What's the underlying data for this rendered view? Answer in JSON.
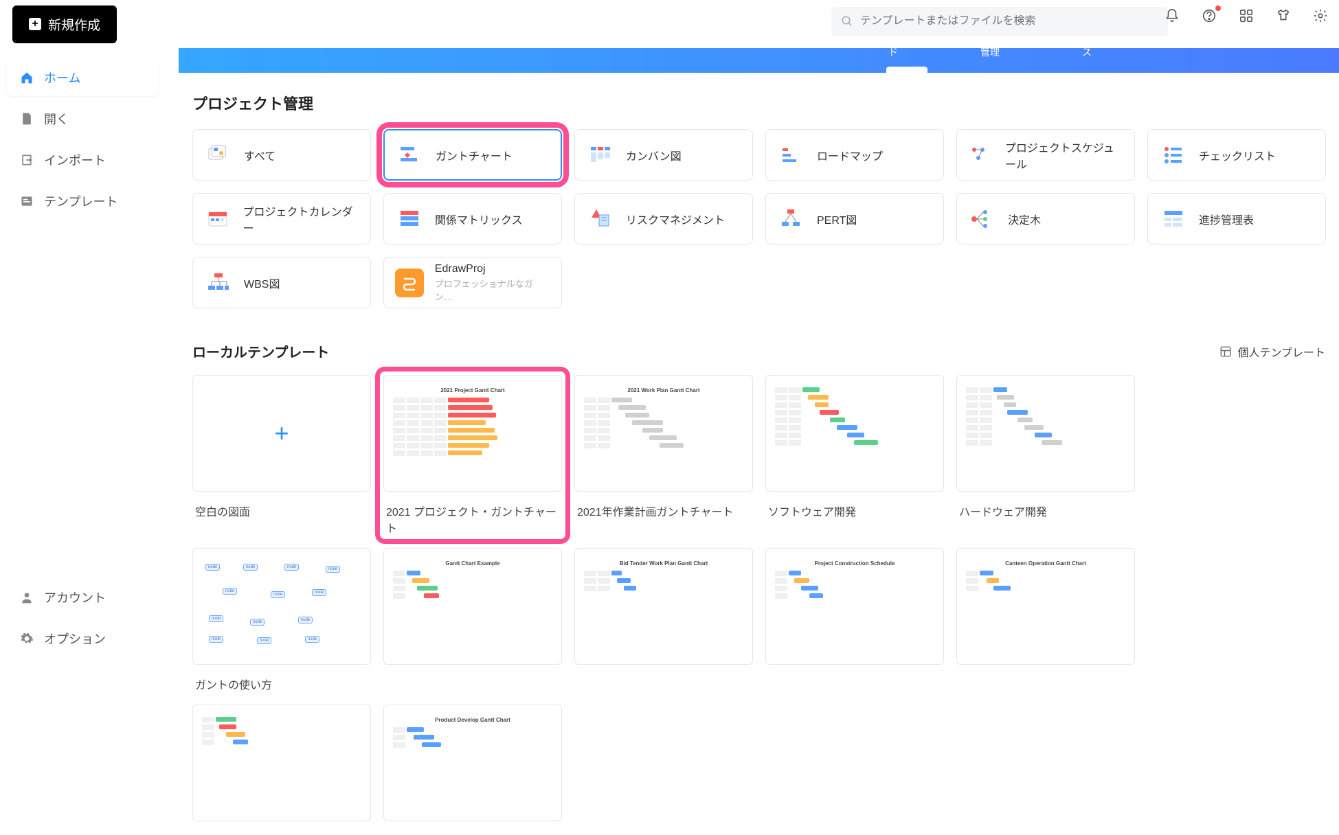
{
  "topbar": {
    "new_button": "新規作成",
    "search_placeholder": "テンプレートまたはファイルを検索"
  },
  "banner_tabs": {
    "t1": "ド",
    "t2": "管理",
    "t3": "ス"
  },
  "sidebar": {
    "items": [
      {
        "label": "ホーム"
      },
      {
        "label": "開く"
      },
      {
        "label": "インポート"
      },
      {
        "label": "テンプレート"
      }
    ],
    "bottom": [
      {
        "label": "アカウント"
      },
      {
        "label": "オプション"
      }
    ]
  },
  "section": {
    "project_mgmt": "プロジェクト管理",
    "local_templates": "ローカルテンプレート",
    "personal_templates": "個人テンプレート"
  },
  "categories": [
    {
      "label": "すべて"
    },
    {
      "label": "ガントチャート"
    },
    {
      "label": "カンバン図"
    },
    {
      "label": "ロードマップ"
    },
    {
      "label": "プロジェクトスケジュール"
    },
    {
      "label": "チェックリスト"
    },
    {
      "label": "プロジェクトカレンダー"
    },
    {
      "label": "関係マトリックス"
    },
    {
      "label": "リスクマネジメント"
    },
    {
      "label": "PERT図"
    },
    {
      "label": "決定木"
    },
    {
      "label": "進捗管理表"
    },
    {
      "label": "WBS図"
    },
    {
      "label": "EdrawProj",
      "sub": "プロフェッショナルなガン…"
    }
  ],
  "templates_row1": [
    {
      "name": "空白の図面"
    },
    {
      "name": "2021 プロジェクト・ガントチャート"
    },
    {
      "name": "2021年作業計画ガントチャート"
    },
    {
      "name": "ソフトウェア開発"
    },
    {
      "name": "ハードウェア開発"
    },
    {
      "name": "ガントの使い方"
    }
  ]
}
